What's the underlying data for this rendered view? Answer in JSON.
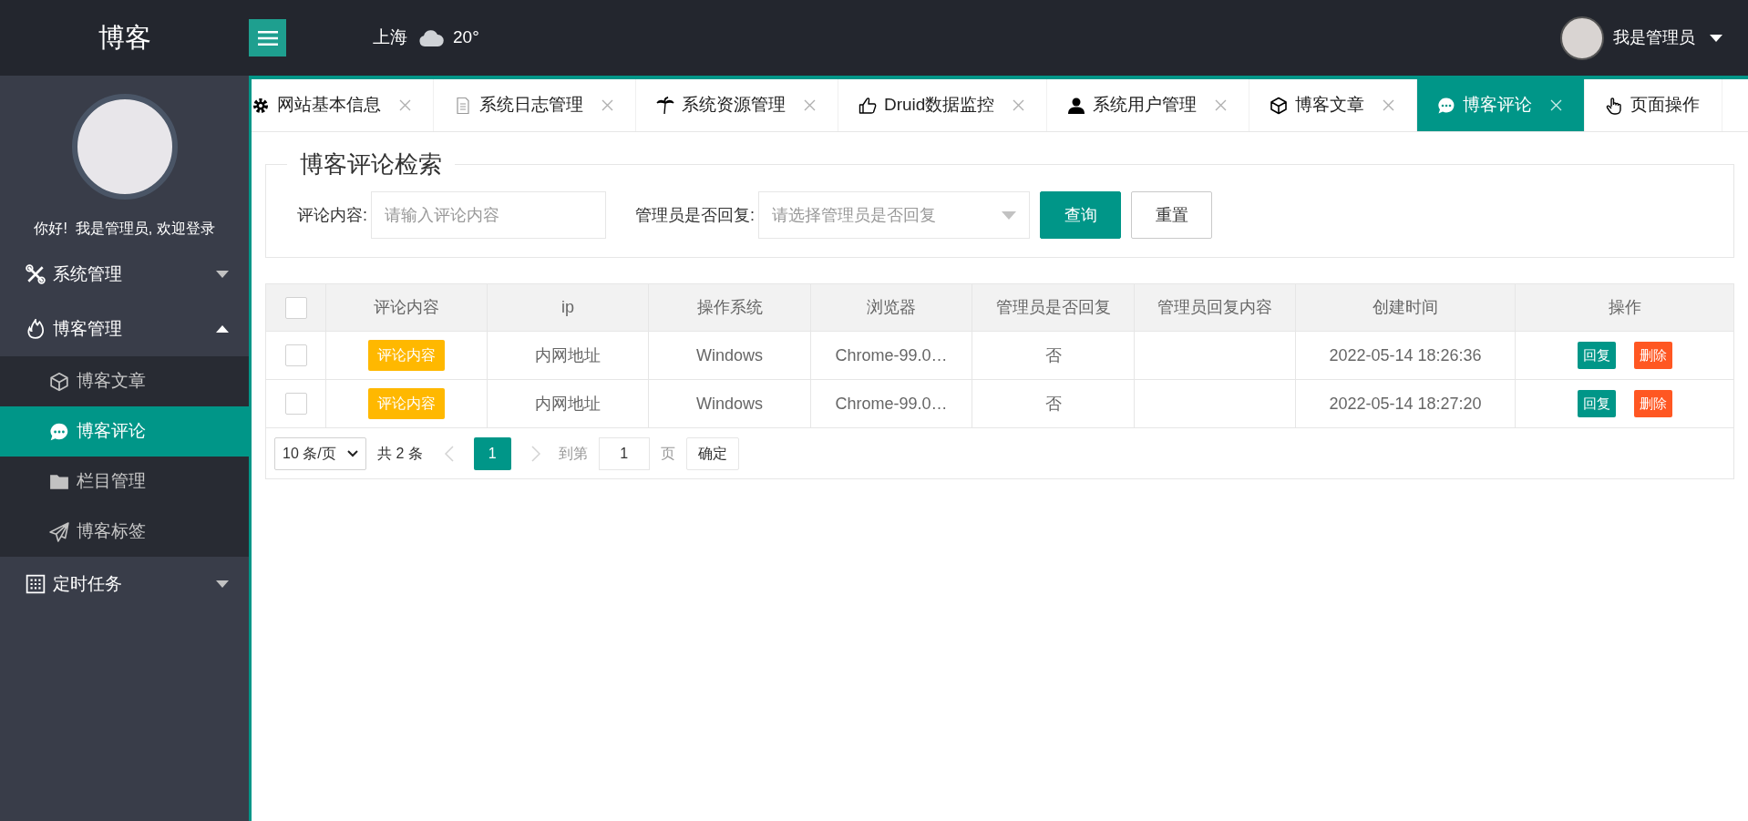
{
  "header": {
    "logo": "博客",
    "weather": {
      "city": "上海",
      "temperature": "20°"
    },
    "user": {
      "name": "我是管理员"
    }
  },
  "sidebar": {
    "welcome": "你好!  我是管理员, 欢迎登录",
    "menu": [
      {
        "label": "系统管理",
        "expanded": false
      },
      {
        "label": "博客管理",
        "expanded": true,
        "children": [
          {
            "label": "博客文章",
            "selected": false
          },
          {
            "label": "博客评论",
            "selected": true
          },
          {
            "label": "栏目管理",
            "selected": false
          },
          {
            "label": "博客标签",
            "selected": false
          }
        ]
      },
      {
        "label": "定时任务",
        "expanded": false
      }
    ]
  },
  "tabs": [
    {
      "label": "网站基本信息",
      "selected": false,
      "closable": true
    },
    {
      "label": "系统日志管理",
      "selected": false,
      "closable": true
    },
    {
      "label": "系统资源管理",
      "selected": false,
      "closable": true
    },
    {
      "label": "Druid数据监控",
      "selected": false,
      "closable": true
    },
    {
      "label": "系统用户管理",
      "selected": false,
      "closable": true
    },
    {
      "label": "博客文章",
      "selected": false,
      "closable": true
    },
    {
      "label": "博客评论",
      "selected": true,
      "closable": true
    },
    {
      "label": "页面操作",
      "selected": false,
      "closable": false
    }
  ],
  "search": {
    "title": "博客评论检索",
    "fields": [
      {
        "kind": "text",
        "label": "评论内容:",
        "placeholder": "请输入评论内容"
      },
      {
        "kind": "select",
        "label": "管理员是否回复:",
        "placeholder": "请选择管理员是否回复"
      }
    ],
    "buttons": [
      {
        "kind": "primary",
        "label": "查询"
      },
      {
        "kind": "default",
        "label": "重置"
      }
    ]
  },
  "table": {
    "all_checked": false,
    "columns": [
      "评论内容",
      "ip",
      "操作系统",
      "浏览器",
      "管理员是否回复",
      "管理员回复内容",
      "创建时间",
      "操作"
    ],
    "rows": [
      {
        "checked": false,
        "comment": "评论内容",
        "ip": "内网地址",
        "os": "Windows",
        "browser": "Chrome-99.0…",
        "replied": "否",
        "created": "2022-05-14 18:26:36",
        "actions": [
          {
            "kind": "primary",
            "label": "回复"
          },
          {
            "kind": "danger",
            "label": "删除"
          }
        ]
      },
      {
        "checked": false,
        "comment": "评论内容",
        "ip": "内网地址",
        "os": "Windows",
        "browser": "Chrome-99.0…",
        "replied": "否",
        "created": "2022-05-14 18:27:20",
        "actions": [
          {
            "kind": "primary",
            "label": "回复"
          },
          {
            "kind": "danger",
            "label": "删除"
          }
        ]
      }
    ]
  },
  "pager": {
    "page_size": "10 条/页",
    "total": "共 2 条",
    "pages": [
      {
        "label": "1",
        "selected": true
      }
    ],
    "goto_label": "到第",
    "goto_value": "1",
    "page_unit": "页",
    "confirm": "确定"
  }
}
